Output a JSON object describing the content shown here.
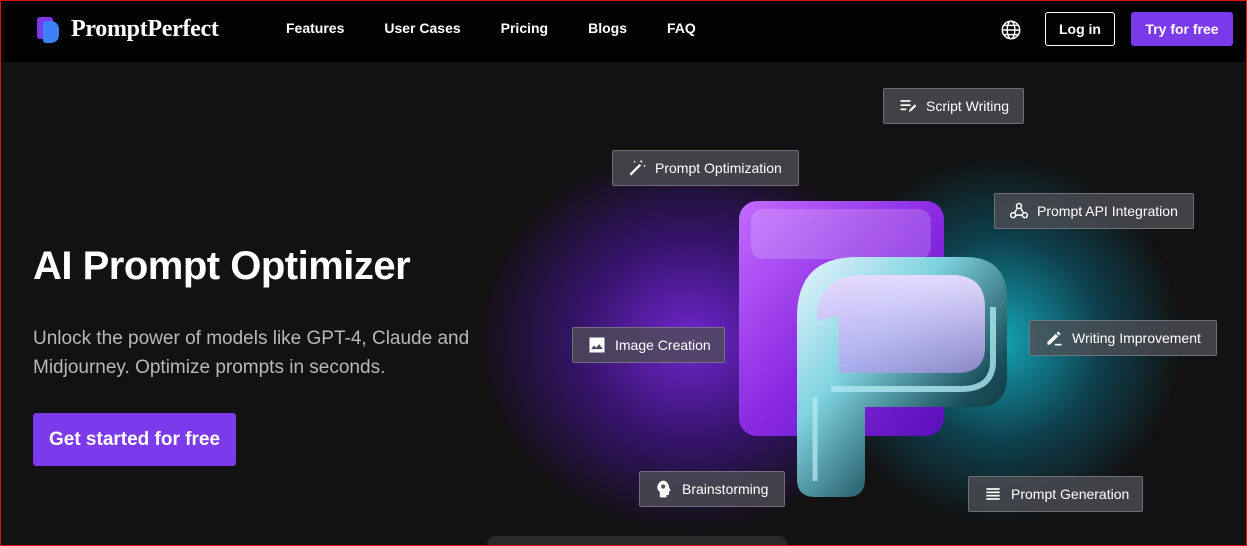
{
  "brand": {
    "name": "PromptPerfect",
    "logo_icon": "promptperfect-logo-icon",
    "accent": "#7c3aed"
  },
  "nav": {
    "items": [
      "Features",
      "User Cases",
      "Pricing",
      "Blogs",
      "FAQ"
    ]
  },
  "header_actions": {
    "language_icon": "globe-icon",
    "login_label": "Log in",
    "try_label": "Try for free"
  },
  "hero": {
    "title": "AI Prompt Optimizer",
    "subtitle": "Unlock the power of models like GPT-4, Claude and Midjourney. Optimize prompts in seconds.",
    "cta_label": "Get started for free"
  },
  "chips": [
    {
      "label": "Script Writing",
      "icon": "script-writing-icon"
    },
    {
      "label": "Prompt Optimization",
      "icon": "magic-wand-icon"
    },
    {
      "label": "Prompt API Integration",
      "icon": "webhook-icon"
    },
    {
      "label": "Image Creation",
      "icon": "image-icon"
    },
    {
      "label": "Writing Improvement",
      "icon": "edit-note-icon"
    },
    {
      "label": "Brainstorming",
      "icon": "brain-head-icon"
    },
    {
      "label": "Prompt Generation",
      "icon": "list-lines-icon"
    }
  ],
  "colors": {
    "purple_glow": "#8028f0",
    "cyan_glow": "#14bed2",
    "header_bg": "#020202",
    "page_bg": "#121212"
  }
}
